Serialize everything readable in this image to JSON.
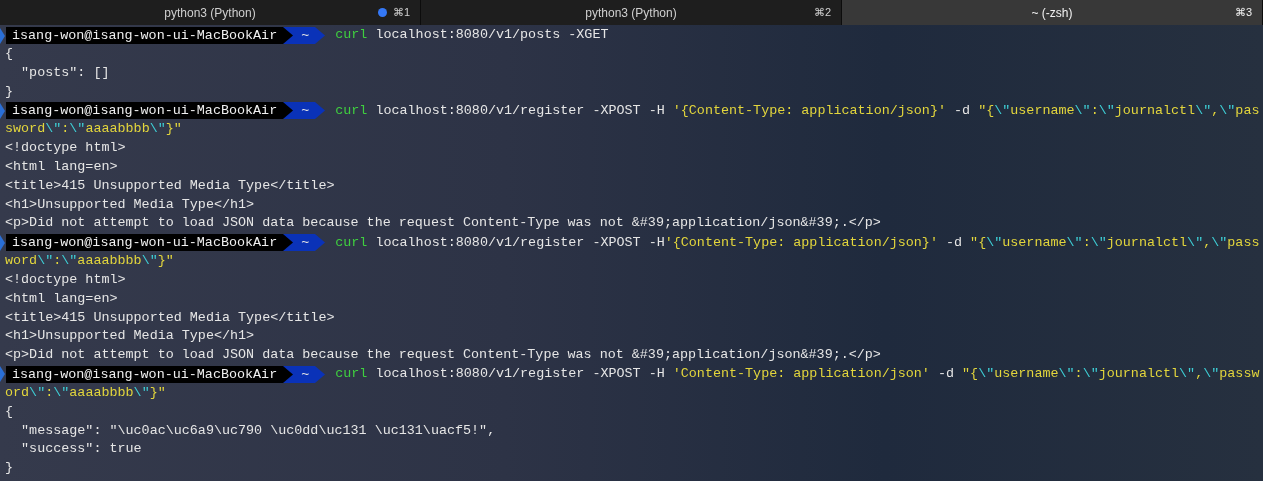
{
  "tabs": [
    {
      "label": "python3 (Python)",
      "shortcut": "⌘1",
      "activity": true,
      "selected": false
    },
    {
      "label": "python3 (Python)",
      "shortcut": "⌘2",
      "activity": false,
      "selected": false
    },
    {
      "label": "~ (-zsh)",
      "shortcut": "⌘3",
      "activity": false,
      "selected": true
    }
  ],
  "lines": [
    {
      "kind": "prompt",
      "user": "isang-won@isang-won-ui-MacBookAir",
      "dir": "~",
      "segments": [
        {
          "kind": "command",
          "text": "curl"
        },
        {
          "kind": "plain",
          "text": " localhost:8080/v1/posts -XGET"
        }
      ]
    },
    {
      "kind": "output",
      "segments": [
        {
          "kind": "plain",
          "text": "{"
        }
      ]
    },
    {
      "kind": "output",
      "segments": [
        {
          "kind": "plain",
          "text": "  \"posts\": []"
        }
      ]
    },
    {
      "kind": "output",
      "segments": [
        {
          "kind": "plain",
          "text": "}"
        }
      ]
    },
    {
      "kind": "prompt",
      "user": "isang-won@isang-won-ui-MacBookAir",
      "dir": "~",
      "segments": [
        {
          "kind": "command",
          "text": "curl"
        },
        {
          "kind": "plain",
          "text": " localhost:8080/v1/register -XPOST -H "
        },
        {
          "kind": "string",
          "text": "'{Content-Type: application/json}'"
        },
        {
          "kind": "plain",
          "text": " -d "
        },
        {
          "kind": "string",
          "text": "\"{"
        },
        {
          "kind": "escape",
          "text": "\\\""
        },
        {
          "kind": "string",
          "text": "username"
        },
        {
          "kind": "escape",
          "text": "\\\""
        },
        {
          "kind": "string",
          "text": ":"
        },
        {
          "kind": "escape",
          "text": "\\\""
        },
        {
          "kind": "string",
          "text": "journalctl"
        },
        {
          "kind": "escape",
          "text": "\\\""
        },
        {
          "kind": "string",
          "text": ","
        },
        {
          "kind": "escape",
          "text": "\\\""
        },
        {
          "kind": "string",
          "text": "pas"
        }
      ]
    },
    {
      "kind": "output",
      "segments": [
        {
          "kind": "string",
          "text": "sword"
        },
        {
          "kind": "escape",
          "text": "\\\""
        },
        {
          "kind": "string",
          "text": ":"
        },
        {
          "kind": "escape",
          "text": "\\\""
        },
        {
          "kind": "string",
          "text": "aaaabbbb"
        },
        {
          "kind": "escape",
          "text": "\\\""
        },
        {
          "kind": "string",
          "text": "}\""
        }
      ]
    },
    {
      "kind": "output",
      "segments": [
        {
          "kind": "plain",
          "text": "<!doctype html>"
        }
      ]
    },
    {
      "kind": "output",
      "segments": [
        {
          "kind": "plain",
          "text": "<html lang=en>"
        }
      ]
    },
    {
      "kind": "output",
      "segments": [
        {
          "kind": "plain",
          "text": "<title>415 Unsupported Media Type</title>"
        }
      ]
    },
    {
      "kind": "output",
      "segments": [
        {
          "kind": "plain",
          "text": "<h1>Unsupported Media Type</h1>"
        }
      ]
    },
    {
      "kind": "output",
      "segments": [
        {
          "kind": "plain",
          "text": "<p>Did not attempt to load JSON data because the request Content-Type was not &#39;application/json&#39;.</p>"
        }
      ]
    },
    {
      "kind": "prompt",
      "user": "isang-won@isang-won-ui-MacBookAir",
      "dir": "~",
      "segments": [
        {
          "kind": "command",
          "text": "curl"
        },
        {
          "kind": "plain",
          "text": " localhost:8080/v1/register -XPOST -H"
        },
        {
          "kind": "string",
          "text": "'{Content-Type: application/json}'"
        },
        {
          "kind": "plain",
          "text": " -d "
        },
        {
          "kind": "string",
          "text": "\"{"
        },
        {
          "kind": "escape",
          "text": "\\\""
        },
        {
          "kind": "string",
          "text": "username"
        },
        {
          "kind": "escape",
          "text": "\\\""
        },
        {
          "kind": "string",
          "text": ":"
        },
        {
          "kind": "escape",
          "text": "\\\""
        },
        {
          "kind": "string",
          "text": "journalctl"
        },
        {
          "kind": "escape",
          "text": "\\\""
        },
        {
          "kind": "string",
          "text": ","
        },
        {
          "kind": "escape",
          "text": "\\\""
        },
        {
          "kind": "string",
          "text": "pass"
        }
      ]
    },
    {
      "kind": "output",
      "segments": [
        {
          "kind": "string",
          "text": "word"
        },
        {
          "kind": "escape",
          "text": "\\\""
        },
        {
          "kind": "string",
          "text": ":"
        },
        {
          "kind": "escape",
          "text": "\\\""
        },
        {
          "kind": "string",
          "text": "aaaabbbb"
        },
        {
          "kind": "escape",
          "text": "\\\""
        },
        {
          "kind": "string",
          "text": "}\""
        }
      ]
    },
    {
      "kind": "output",
      "segments": [
        {
          "kind": "plain",
          "text": "<!doctype html>"
        }
      ]
    },
    {
      "kind": "output",
      "segments": [
        {
          "kind": "plain",
          "text": "<html lang=en>"
        }
      ]
    },
    {
      "kind": "output",
      "segments": [
        {
          "kind": "plain",
          "text": "<title>415 Unsupported Media Type</title>"
        }
      ]
    },
    {
      "kind": "output",
      "segments": [
        {
          "kind": "plain",
          "text": "<h1>Unsupported Media Type</h1>"
        }
      ]
    },
    {
      "kind": "output",
      "segments": [
        {
          "kind": "plain",
          "text": "<p>Did not attempt to load JSON data because the request Content-Type was not &#39;application/json&#39;.</p>"
        }
      ]
    },
    {
      "kind": "prompt",
      "user": "isang-won@isang-won-ui-MacBookAir",
      "dir": "~",
      "segments": [
        {
          "kind": "command",
          "text": "curl"
        },
        {
          "kind": "plain",
          "text": " localhost:8080/v1/register -XPOST -H "
        },
        {
          "kind": "string",
          "text": "'Content-Type: application/json'"
        },
        {
          "kind": "plain",
          "text": " -d "
        },
        {
          "kind": "string",
          "text": "\"{"
        },
        {
          "kind": "escape",
          "text": "\\\""
        },
        {
          "kind": "string",
          "text": "username"
        },
        {
          "kind": "escape",
          "text": "\\\""
        },
        {
          "kind": "string",
          "text": ":"
        },
        {
          "kind": "escape",
          "text": "\\\""
        },
        {
          "kind": "string",
          "text": "journalctl"
        },
        {
          "kind": "escape",
          "text": "\\\""
        },
        {
          "kind": "string",
          "text": ","
        },
        {
          "kind": "escape",
          "text": "\\\""
        },
        {
          "kind": "string",
          "text": "passw"
        }
      ]
    },
    {
      "kind": "output",
      "segments": [
        {
          "kind": "string",
          "text": "ord"
        },
        {
          "kind": "escape",
          "text": "\\\""
        },
        {
          "kind": "string",
          "text": ":"
        },
        {
          "kind": "escape",
          "text": "\\\""
        },
        {
          "kind": "string",
          "text": "aaaabbbb"
        },
        {
          "kind": "escape",
          "text": "\\\""
        },
        {
          "kind": "string",
          "text": "}\""
        }
      ]
    },
    {
      "kind": "output",
      "segments": [
        {
          "kind": "plain",
          "text": "{"
        }
      ]
    },
    {
      "kind": "output",
      "segments": [
        {
          "kind": "plain",
          "text": "  \"message\": \"\\uc0ac\\uc6a9\\uc790 \\uc0dd\\uc131 \\uc131\\uacf5!\","
        }
      ]
    },
    {
      "kind": "output",
      "segments": [
        {
          "kind": "plain",
          "text": "  \"success\": true"
        }
      ]
    },
    {
      "kind": "output",
      "segments": [
        {
          "kind": "plain",
          "text": "}"
        }
      ]
    }
  ]
}
